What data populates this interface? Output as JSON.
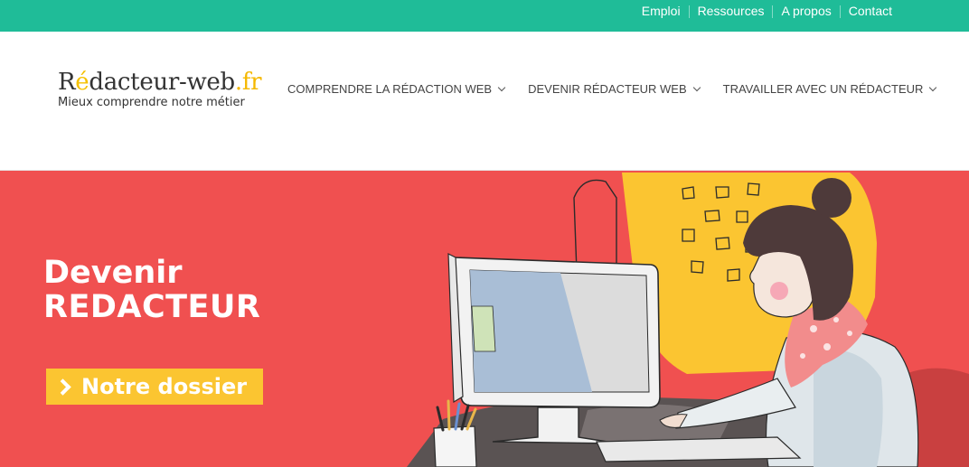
{
  "topnav": {
    "links": [
      "Emploi",
      "Ressources",
      "A propos",
      "Contact"
    ]
  },
  "logo": {
    "title_r": "R",
    "title_e": "é",
    "title_rest": "dacteur-web",
    "title_tld": ".fr",
    "tagline": "Mieux comprendre notre métier"
  },
  "mainnav": {
    "items": [
      "COMPRENDRE LA RÉDACTION WEB",
      "DEVENIR RÉDACTEUR WEB",
      "TRAVAILLER AVEC UN RÉDACTEUR"
    ]
  },
  "hero": {
    "line1": "Devenir",
    "line2": "REDACTEUR",
    "cta": "Notre dossier"
  },
  "colors": {
    "topbar": "#1fbc98",
    "hero_bg": "#f05050",
    "cta_bg": "#fbc531",
    "logo_accent": "#f5c100"
  }
}
